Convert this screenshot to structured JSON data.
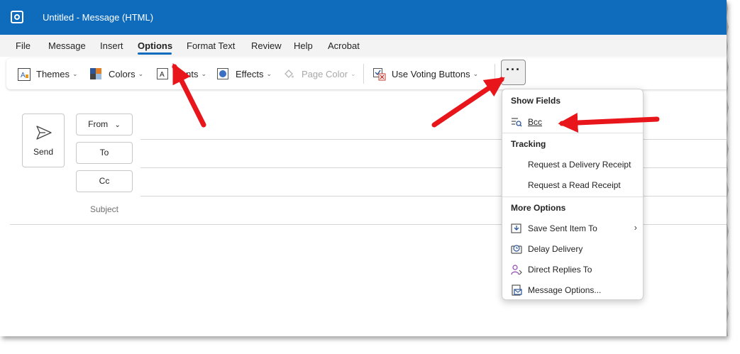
{
  "titlebar": {
    "title": "Untitled  -  Message (HTML)"
  },
  "menu": {
    "items": [
      "File",
      "Message",
      "Insert",
      "Options",
      "Format Text",
      "Review",
      "Help",
      "Acrobat"
    ],
    "active": "Options"
  },
  "ribbon": {
    "themes": "Themes",
    "colors": "Colors",
    "fonts": "Fonts",
    "effects": "Effects",
    "page_color": "Page Color",
    "voting": "Use Voting Buttons",
    "more": "···"
  },
  "compose": {
    "send": "Send",
    "from": "From",
    "to": "To",
    "cc": "Cc",
    "subject": "Subject"
  },
  "dropdown": {
    "show_fields_header": "Show Fields",
    "bcc": "Bcc",
    "tracking_header": "Tracking",
    "delivery_receipt": "Request a Delivery Receipt",
    "read_receipt": "Request a Read Receipt",
    "more_options_header": "More Options",
    "save_sent_item": "Save Sent Item To",
    "delay_delivery": "Delay Delivery",
    "direct_replies": "Direct Replies To",
    "message_options": "Message Options..."
  },
  "colors": {
    "titlebar": "#0f6cbd",
    "accent": "#0f6cbd",
    "annotation_arrow": "#e8151b"
  }
}
